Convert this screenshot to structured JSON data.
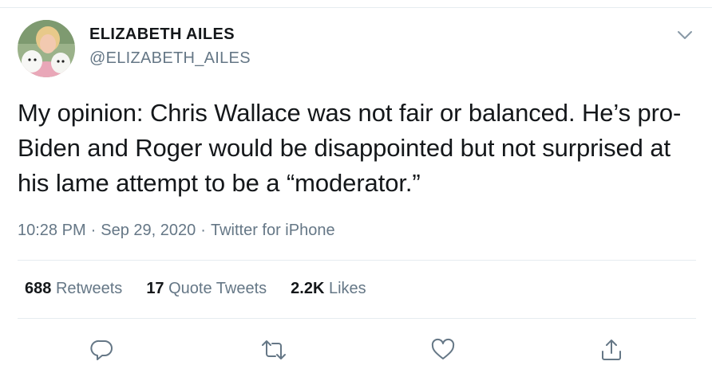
{
  "user": {
    "display_name": "ELIZABETH AILES",
    "handle": "@ELIZABETH_AILES",
    "avatar_icon": "profile-photo"
  },
  "tweet": {
    "text": "My opinion: Chris Wallace was not fair or balanced. He’s pro-Biden and Roger would be disappointed but not surprised at his lame attempt to be a “moderator.”",
    "time": "10:28 PM",
    "separator": "·",
    "date": "Sep 29, 2020",
    "source": "Twitter for iPhone"
  },
  "stats": {
    "retweets_count": "688",
    "retweets_label": "Retweets",
    "quotes_count": "17",
    "quotes_label": "Quote Tweets",
    "likes_count": "2.2K",
    "likes_label": "Likes"
  },
  "actions": [
    "reply-icon",
    "retweet-icon",
    "like-icon",
    "share-icon"
  ],
  "colors": {
    "text": "#14171a",
    "secondary": "#657786",
    "divider": "#e6ecf0"
  }
}
